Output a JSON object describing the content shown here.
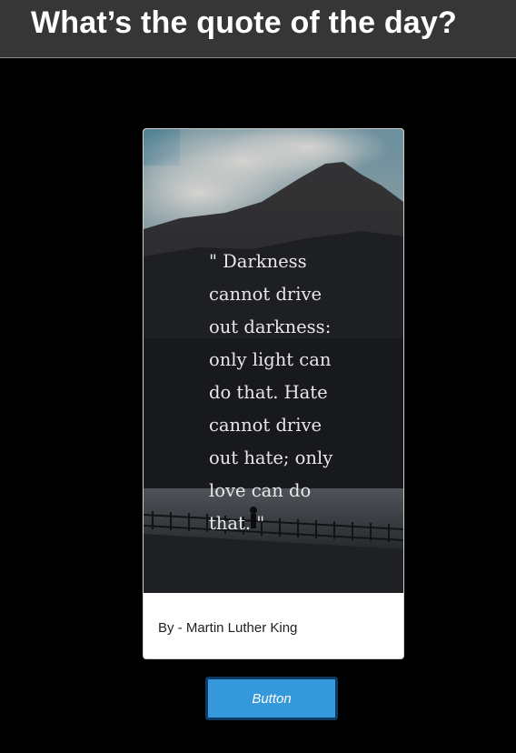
{
  "header": {
    "title": "What’s the quote of the day?"
  },
  "quote_card": {
    "image": "mountain-lake-photo",
    "quote": "\" Darkness cannot drive out darkness: only light can do that. Hate cannot drive out hate; only love can do that. \"",
    "author": "By - Martin Luther King"
  },
  "action": {
    "button_label": "Button",
    "color": "#3498db"
  },
  "colors": {
    "page_background": "#000000",
    "header_background": "#363636"
  }
}
